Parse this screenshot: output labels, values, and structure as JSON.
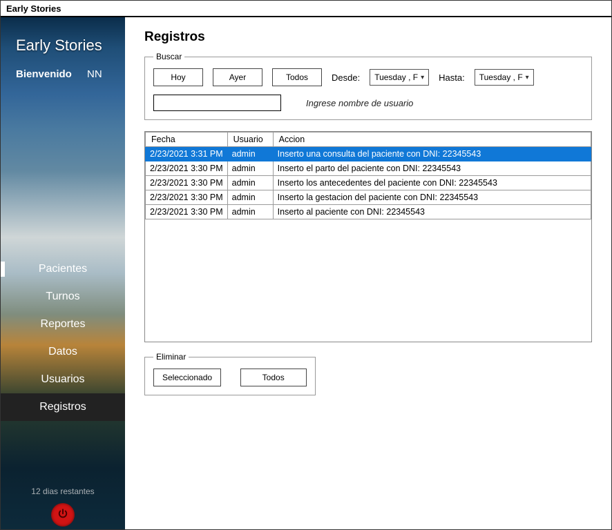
{
  "app_title": "Early Stories",
  "sidebar": {
    "brand": "Early Stories",
    "welcome_label": "Bienvenido",
    "user_initials": "NN",
    "items": [
      {
        "label": "Pacientes"
      },
      {
        "label": "Turnos"
      },
      {
        "label": "Reportes"
      },
      {
        "label": "Datos"
      },
      {
        "label": "Usuarios"
      },
      {
        "label": "Registros"
      }
    ],
    "active_index": 5,
    "trial_text": "12 dias restantes"
  },
  "page": {
    "title": "Registros",
    "search": {
      "legend": "Buscar",
      "btn_today": "Hoy",
      "btn_yesterday": "Ayer",
      "btn_all": "Todos",
      "from_label": "Desde:",
      "to_label": "Hasta:",
      "date_from": "Tuesday , F",
      "date_to": "Tuesday , F",
      "search_input_value": "",
      "hint": "Ingrese nombre de usuario"
    },
    "table": {
      "columns": [
        "Fecha",
        "Usuario",
        "Accion"
      ],
      "rows": [
        {
          "fecha": "2/23/2021 3:31 PM",
          "usuario": "admin",
          "accion": "Inserto una consulta del paciente con DNI: 22345543",
          "selected": true
        },
        {
          "fecha": "2/23/2021 3:30 PM",
          "usuario": "admin",
          "accion": "Inserto el parto del paciente con DNI: 22345543",
          "selected": false
        },
        {
          "fecha": "2/23/2021 3:30 PM",
          "usuario": "admin",
          "accion": "Inserto los antecedentes del paciente con DNI: 22345543",
          "selected": false
        },
        {
          "fecha": "2/23/2021 3:30 PM",
          "usuario": "admin",
          "accion": "Inserto la gestacion del paciente con DNI: 22345543",
          "selected": false
        },
        {
          "fecha": "2/23/2021 3:30 PM",
          "usuario": "admin",
          "accion": "Inserto al paciente con DNI: 22345543",
          "selected": false
        }
      ]
    },
    "delete": {
      "legend": "Eliminar",
      "btn_selected": "Seleccionado",
      "btn_all": "Todos"
    }
  }
}
